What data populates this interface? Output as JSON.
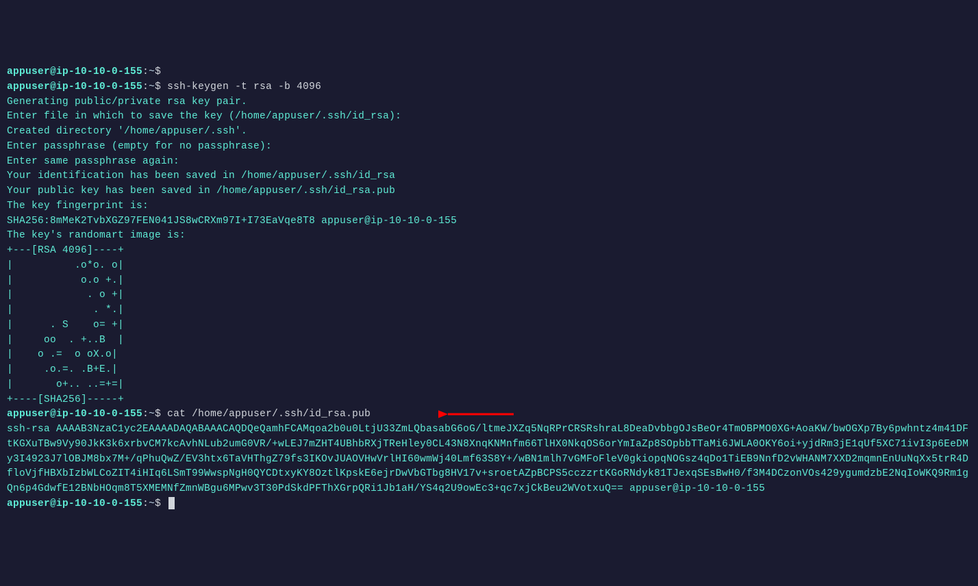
{
  "prompt": {
    "user": "appuser",
    "host": "ip-10-10-0-155",
    "path": "~",
    "dollar": "$"
  },
  "commands": {
    "empty": "",
    "keygen": "ssh-keygen -t rsa -b 4096",
    "cat": "cat /home/appuser/.ssh/id_rsa.pub"
  },
  "output": {
    "gen1": "Generating public/private rsa key pair.",
    "gen2": "Enter file in which to save the key (/home/appuser/.ssh/id_rsa):",
    "gen3": "Created directory '/home/appuser/.ssh'.",
    "gen4": "Enter passphrase (empty for no passphrase):",
    "gen5": "Enter same passphrase again:",
    "gen6": "Your identification has been saved in /home/appuser/.ssh/id_rsa",
    "gen7": "Your public key has been saved in /home/appuser/.ssh/id_rsa.pub",
    "gen8": "The key fingerprint is:",
    "gen9": "SHA256:8mMeK2TvbXGZ97FEN041JS8wCRXm97I+I73EaVqe8T8 appuser@ip-10-10-0-155",
    "gen10": "The key's randomart image is:",
    "art1": "+---[RSA 4096]----+",
    "art2": "|          .o*o. o|",
    "art3": "|           o.o +.|",
    "art4": "|            . o +|",
    "art5": "|             . *.|",
    "art6": "|      . S    o= +|",
    "art7": "|     oo  . +..B  |",
    "art8": "|    o .=  o oX.o|",
    "art9": "|     .o.=. .B+E.|",
    "art10": "|       o+.. ..=+=|",
    "art11": "+----[SHA256]-----+",
    "pubkey": "ssh-rsa AAAAB3NzaC1yc2EAAAADAQABAAACAQDQeQamhFCAMqoa2b0u0LtjU33ZmLQbasabG6oG/ltmeJXZq5NqRPrCRSRshraL8DeaDvbbgOJsBeOr4TmOBPMO0XG+AoaKW/bwOGXp7By6pwhntz4m41DFtKGXuTBw9Vy90JkK3k6xrbvCM7kcAvhNLub2umG0VR/+wLEJ7mZHT4UBhbRXjTReHley0CL43N8XnqKNMnfm66TlHX0NkqOS6orYmIaZp8SOpbbTTaMi6JWLA0OKY6oi+yjdRm3jE1qUf5XC71ivI3p6EeDMy3I4923J7lOBJM8bx7M+/qPhuQwZ/EV3htx6TaVHThgZ79fs3IKOvJUAOVHwVrlHI60wmWj40Lmf63S8Y+/wBN1mlh7vGMFoFleV0gkiopqNOGsz4qDo1TiEB9NnfD2vWHANM7XXD2mqmnEnUuNqXx5trR4DfloVjfHBXbIzbWLCoZIT4iHIq6LSmT99WwspNgH0QYCDtxyKY8OztlKpskE6ejrDwVbGTbg8HV17v+sroetAZpBCPS5cczzrtKGoRNdyk81TJexqSEsBwH0/f3M4DCzonVOs429ygumdzbE2NqIoWKQ9Rm1gQn6p4GdwfE12BNbHOqm8T5XMEMNfZmnWBgu6MPwv3T30PdSkdPFThXGrpQRi1Jb1aH/YS4q2U9owEc3+qc7xjCkBeu2WVotxuQ== appuser@ip-10-10-0-155"
  }
}
